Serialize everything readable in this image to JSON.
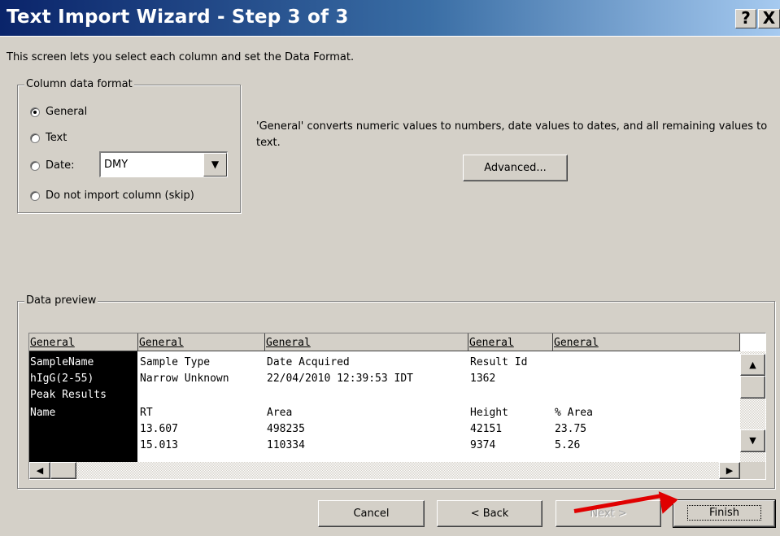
{
  "window": {
    "title": "Text Import Wizard - Step 3 of 3",
    "help_label": "?",
    "close_label": "X"
  },
  "intro_text": "This screen lets you select each column and set the Data Format.",
  "column_format": {
    "group_label": "Column data format",
    "options": [
      {
        "label": "General",
        "checked": true
      },
      {
        "label": "Text",
        "checked": false
      },
      {
        "label": "Date:",
        "checked": false
      },
      {
        "label": "Do not import column (skip)",
        "checked": false
      }
    ],
    "date_value": "DMY"
  },
  "description": "'General' converts numeric values to numbers, date values to dates, and all remaining values to text.",
  "advanced_label": "Advanced...",
  "preview": {
    "group_label": "Data preview",
    "headers": [
      "General",
      "General",
      "General",
      "General",
      "General"
    ],
    "rows": [
      [
        "SampleName",
        "Sample Type",
        "Date Acquired",
        "Result Id",
        ""
      ],
      [
        "hIgG(2-55)",
        "Narrow Unknown",
        "22/04/2010 12:39:53 IDT",
        "1362",
        ""
      ],
      [
        "Peak Results",
        "",
        "",
        "",
        ""
      ],
      [
        "Name",
        "RT",
        "Area",
        "Height",
        "% Area"
      ],
      [
        "",
        "13.607",
        "498235",
        "42151",
        "23.75"
      ],
      [
        "",
        "15.013",
        "110334",
        "9374",
        "5.26"
      ]
    ]
  },
  "buttons": {
    "cancel": "Cancel",
    "back": "< Back",
    "next": "Next >",
    "finish": "Finish"
  },
  "colors": {
    "annotation_arrow": "#e00000",
    "title_bar_start": "#0a246a",
    "title_bar_end": "#a6caf0"
  }
}
